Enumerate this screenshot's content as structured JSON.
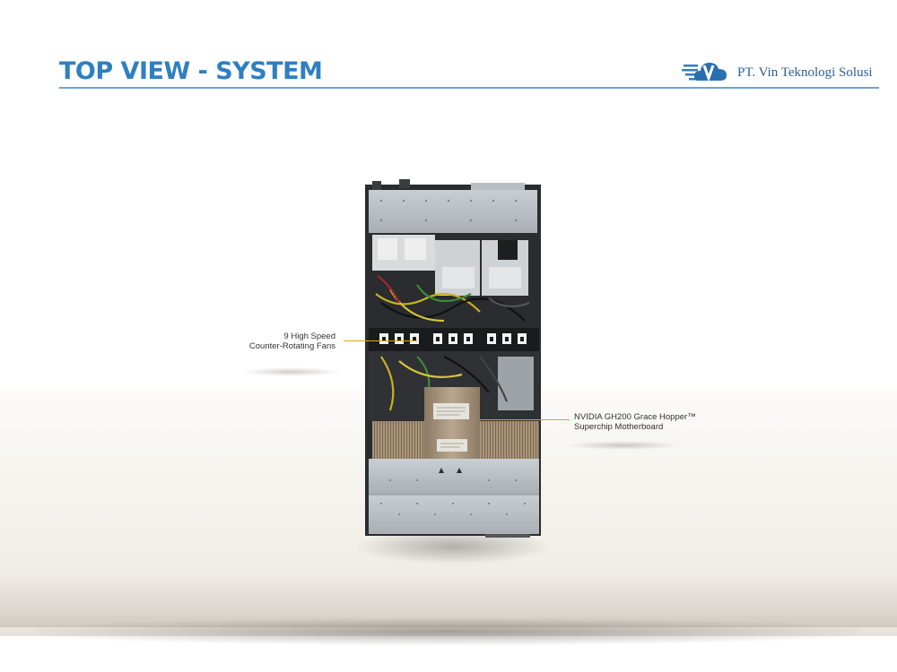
{
  "header": {
    "title": "TOP VIEW - SYSTEM",
    "logo_text": "PT. Vin Teknologi Solusi",
    "logo_letter": "V",
    "accent": "#2f7fc1",
    "logo_color": "#2a5f98"
  },
  "annotations": {
    "fans_line1": "9 High Speed",
    "fans_line2": "Counter-Rotating  Fans",
    "mb_line1": "NVIDIA GH200 Grace Hopper™",
    "mb_line2": "Superchip Motherboard",
    "leader_color": "#e1a21d"
  },
  "image": {
    "subject": "server-top-view",
    "fan_count": 9
  }
}
